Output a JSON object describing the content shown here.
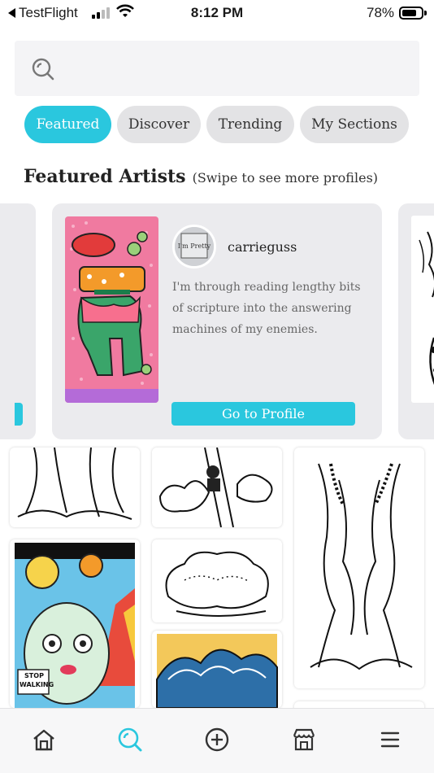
{
  "status_bar": {
    "back_app": "TestFlight",
    "time": "8:12 PM",
    "battery_pct": "78%",
    "battery_level": 0.78
  },
  "search": {
    "placeholder": ""
  },
  "tabs": [
    {
      "label": "Featured",
      "active": true
    },
    {
      "label": "Discover",
      "active": false
    },
    {
      "label": "Trending",
      "active": false
    },
    {
      "label": "My Sections",
      "active": false
    }
  ],
  "featured": {
    "title": "Featured Artists",
    "subtitle": "(Swipe to see more profiles)"
  },
  "artist_card": {
    "username": "carrieguss",
    "avatar_text": "I'm Pretty",
    "bio": "I'm through reading lengthy bits of scripture into the answering machines of my enemies.",
    "button_label": "Go to Profile"
  },
  "feed": {
    "stop_sign_text": "STOP WALKING"
  },
  "bottom_nav": {
    "items": [
      "home-icon",
      "discover-icon",
      "add-icon",
      "shop-icon",
      "menu-icon"
    ],
    "active": "discover-icon"
  },
  "colors": {
    "accent": "#2ac7de",
    "tab_inactive": "#e3e3e5",
    "card_bg": "#ebebee"
  }
}
